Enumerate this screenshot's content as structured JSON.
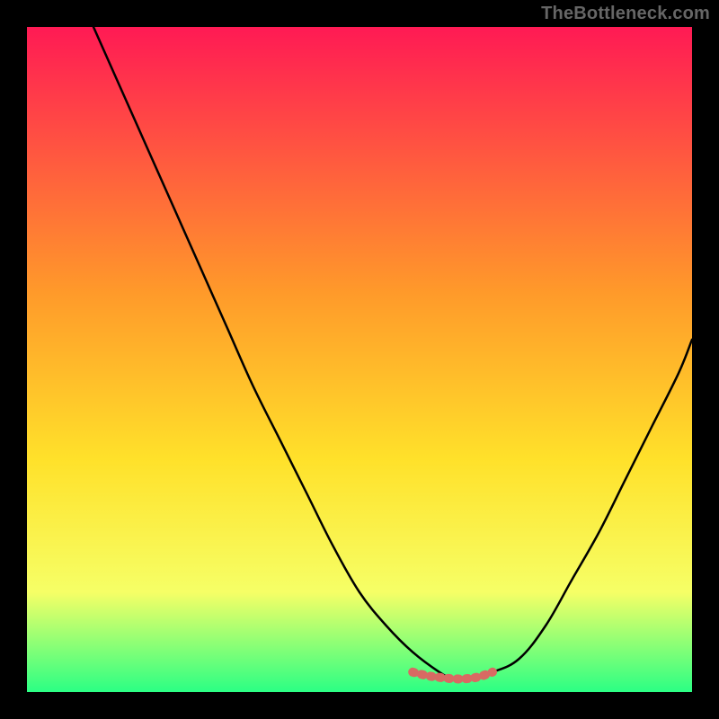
{
  "watermark": "TheBottleneck.com",
  "colors": {
    "frame_bg": "#000000",
    "gradient_top": "#ff1a54",
    "gradient_mid1": "#ff9a2a",
    "gradient_mid2": "#ffe12a",
    "gradient_mid3": "#f6ff66",
    "gradient_bottom": "#2bff84",
    "curve_stroke": "#000000",
    "marker_stroke": "#d86a63"
  },
  "chart_data": {
    "type": "line",
    "title": "",
    "xlabel": "",
    "ylabel": "",
    "xlim": [
      0,
      100
    ],
    "ylim": [
      0,
      100
    ],
    "grid": false,
    "legend": false,
    "series": [
      {
        "name": "bottleneck-curve",
        "x": [
          10,
          14,
          18,
          22,
          26,
          30,
          34,
          38,
          42,
          46,
          50,
          54,
          58,
          62,
          64,
          66,
          70,
          74,
          78,
          82,
          86,
          90,
          94,
          98,
          100
        ],
        "y": [
          100,
          91,
          82,
          73,
          64,
          55,
          46,
          38,
          30,
          22,
          15,
          10,
          6,
          3,
          2,
          2,
          3,
          5,
          10,
          17,
          24,
          32,
          40,
          48,
          53
        ]
      },
      {
        "name": "optimal-zone-marker",
        "x": [
          58,
          60,
          62,
          64,
          66,
          68,
          70
        ],
        "y": [
          3,
          2.5,
          2.2,
          2,
          2,
          2.3,
          3
        ]
      }
    ],
    "annotations": []
  }
}
